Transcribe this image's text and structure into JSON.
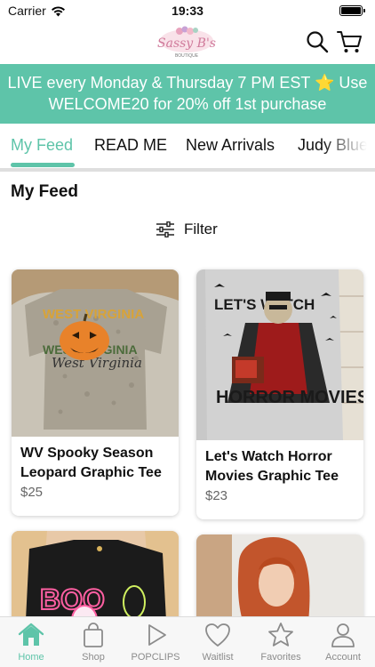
{
  "status_bar": {
    "carrier": "Carrier",
    "time": "19:33"
  },
  "header": {
    "logo_text": "Sassy B's",
    "logo_subtext": "BOUTIQUE"
  },
  "promo": {
    "line1": "LIVE every Monday & Thursday 7 PM EST ⭐ Use",
    "line2": "WELCOME20 for 20% off 1st purchase"
  },
  "tabs": [
    {
      "label": "My Feed",
      "active": true
    },
    {
      "label": "READ ME",
      "active": false
    },
    {
      "label": "New Arrivals",
      "active": false
    },
    {
      "label": "Judy Blue",
      "active": false
    }
  ],
  "feed": {
    "title": "My Feed",
    "filter_label": "Filter"
  },
  "products": [
    {
      "title": "WV Spooky Season Leopard Graphic Tee",
      "price": "$25",
      "image_text": "West Virginia"
    },
    {
      "title": "Let's Watch Horror Movies Graphic Tee",
      "price": "$23",
      "image_text_top": "LET'S WATCH",
      "image_text_bottom": "HORROR MOVIES"
    },
    {
      "title": "",
      "price": "",
      "image_text": "BOO"
    },
    {
      "title": "",
      "price": ""
    }
  ],
  "tabbar": [
    {
      "label": "Home",
      "icon": "home-icon",
      "active": true
    },
    {
      "label": "Shop",
      "icon": "shopping-bag-icon",
      "active": false
    },
    {
      "label": "POPCLIPS",
      "icon": "play-icon",
      "active": false
    },
    {
      "label": "Waitlist",
      "icon": "heart-icon",
      "active": false
    },
    {
      "label": "Favorites",
      "icon": "star-icon",
      "active": false
    },
    {
      "label": "Account",
      "icon": "person-icon",
      "active": false
    }
  ],
  "colors": {
    "accent": "#5ec4a9",
    "inactive": "#8b8b8b"
  }
}
